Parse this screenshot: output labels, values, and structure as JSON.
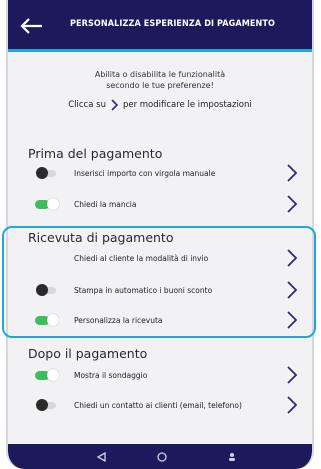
{
  "header": {
    "title": "PERSONALIZZA ESPERIENZA DI PAGAMENTO",
    "back_icon": "arrow-left-icon"
  },
  "intro": {
    "line1": "Abilita o disabilita le funzionalità",
    "line2": "secondo le tue preferenze!",
    "hint_prefix": "Clicca su",
    "hint_suffix": "per modificare le impostazioni"
  },
  "sections": {
    "before": {
      "title": "Prima del pagamento",
      "items": [
        {
          "label": "Inserisci importo con virgola manuale",
          "enabled": false
        },
        {
          "label": "Chiedi la mancia",
          "enabled": true
        }
      ]
    },
    "receipt": {
      "title": "Ricevuta di pagamento",
      "items": [
        {
          "label": "Chiedi al cliente la modalità di invio"
        },
        {
          "label": "Stampa in automatico i buoni sconto",
          "enabled": false
        },
        {
          "label": "Personalizza la ricevuta",
          "enabled": true
        }
      ]
    },
    "after": {
      "title": "Dopo il pagamento",
      "items": [
        {
          "label": "Mostra il sondaggio",
          "enabled": true
        },
        {
          "label": "Chiedi un contatto ai clienti (email, telefono)",
          "enabled": false
        }
      ]
    }
  },
  "colors": {
    "navy": "#1d1a5c",
    "accent_blue": "#1ea8df",
    "toggle_on": "#3fbd5c"
  },
  "navbar": {
    "icons": [
      "back-triangle-icon",
      "home-circle-icon",
      "person-icon"
    ]
  }
}
